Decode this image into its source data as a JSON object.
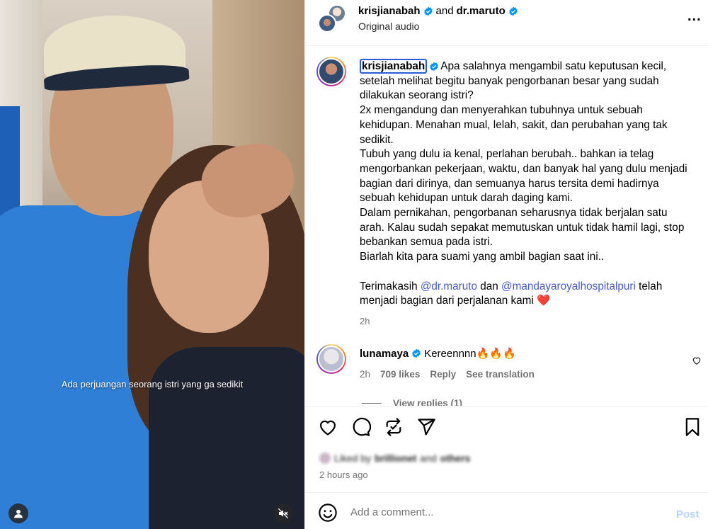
{
  "media": {
    "caption": "Ada perjuangan seorang istri yang ga sedikit",
    "user_icon": "user-icon",
    "mute_icon": "muted-speaker-icon"
  },
  "header": {
    "username": "krisjianabah",
    "joiner": "and",
    "collaborator": "dr.maruto",
    "audio": "Original audio",
    "more_icon": "more-horizontal-icon",
    "more_label": "..."
  },
  "caption_post": {
    "username": "krisjianabah",
    "paragraphs": [
      "Apa salahnya mengambil satu keputusan kecil, setelah melihat begitu banyak pengorbanan besar yang sudah dilakukan seorang istri?",
      "2x mengandung dan menyerahkan tubuhnya untuk sebuah kehidupan. Menahan mual, lelah, sakit, dan perubahan yang tak sedikit.",
      "Tubuh yang dulu ia kenal, perlahan berubah.. bahkan ia telag mengorbankan pekerjaan, waktu, dan banyak hal yang dulu menjadi bagian dari dirinya, dan semuanya harus tersita demi hadirnya sebuah kehidupan untuk darah daging kami.",
      "Dalam pernikahan, pengorbanan seharusnya tidak berjalan satu arah. Kalau sudah sepakat memutuskan untuk tidak hamil lagi, stop bebankan semua pada istri.",
      "Biarlah kita para suami yang ambil bagian saat ini.."
    ],
    "thanks_prefix": "Terimakasih",
    "mention_1": "@dr.maruto",
    "thanks_mid": "dan",
    "mention_2": "@mandayaroyalhospitalpuri",
    "thanks_suffix": "telah menjadi bagian dari perjalanan kami",
    "heart": "❤️",
    "time": "2h"
  },
  "comment": {
    "username": "lunamaya",
    "text": "Kereennnn🔥🔥🔥",
    "time": "2h",
    "likes": "709 likes",
    "reply": "Reply",
    "translate": "See translation",
    "view_replies": "View replies (1)"
  },
  "actions": {
    "like_icon": "heart-icon",
    "comment_icon": "comment-icon",
    "repost_icon": "repost-icon",
    "share_icon": "share-icon",
    "save_icon": "bookmark-icon"
  },
  "likes_line": {
    "prefix": "Liked by",
    "user": "brillionet",
    "mid": "and",
    "others": "others"
  },
  "posted_ago": "2 hours ago",
  "composer": {
    "placeholder": "Add a comment...",
    "post": "Post",
    "emoji_icon": "smiley-icon"
  },
  "colors": {
    "verified": "#0095f6",
    "mention": "#4a5bbf",
    "post_disabled": "#b3d4fc",
    "muted_text": "#737373"
  }
}
